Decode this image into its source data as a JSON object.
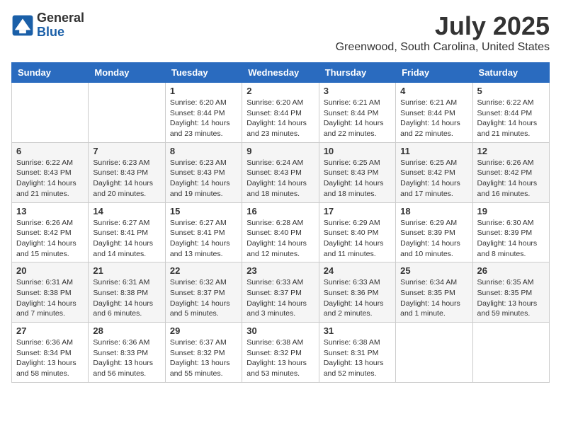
{
  "header": {
    "logo_line1": "General",
    "logo_line2": "Blue",
    "month": "July 2025",
    "location": "Greenwood, South Carolina, United States"
  },
  "weekdays": [
    "Sunday",
    "Monday",
    "Tuesday",
    "Wednesday",
    "Thursday",
    "Friday",
    "Saturday"
  ],
  "weeks": [
    [
      {
        "day": "",
        "info": ""
      },
      {
        "day": "",
        "info": ""
      },
      {
        "day": "1",
        "info": "Sunrise: 6:20 AM\nSunset: 8:44 PM\nDaylight: 14 hours and 23 minutes."
      },
      {
        "day": "2",
        "info": "Sunrise: 6:20 AM\nSunset: 8:44 PM\nDaylight: 14 hours and 23 minutes."
      },
      {
        "day": "3",
        "info": "Sunrise: 6:21 AM\nSunset: 8:44 PM\nDaylight: 14 hours and 22 minutes."
      },
      {
        "day": "4",
        "info": "Sunrise: 6:21 AM\nSunset: 8:44 PM\nDaylight: 14 hours and 22 minutes."
      },
      {
        "day": "5",
        "info": "Sunrise: 6:22 AM\nSunset: 8:44 PM\nDaylight: 14 hours and 21 minutes."
      }
    ],
    [
      {
        "day": "6",
        "info": "Sunrise: 6:22 AM\nSunset: 8:43 PM\nDaylight: 14 hours and 21 minutes."
      },
      {
        "day": "7",
        "info": "Sunrise: 6:23 AM\nSunset: 8:43 PM\nDaylight: 14 hours and 20 minutes."
      },
      {
        "day": "8",
        "info": "Sunrise: 6:23 AM\nSunset: 8:43 PM\nDaylight: 14 hours and 19 minutes."
      },
      {
        "day": "9",
        "info": "Sunrise: 6:24 AM\nSunset: 8:43 PM\nDaylight: 14 hours and 18 minutes."
      },
      {
        "day": "10",
        "info": "Sunrise: 6:25 AM\nSunset: 8:43 PM\nDaylight: 14 hours and 18 minutes."
      },
      {
        "day": "11",
        "info": "Sunrise: 6:25 AM\nSunset: 8:42 PM\nDaylight: 14 hours and 17 minutes."
      },
      {
        "day": "12",
        "info": "Sunrise: 6:26 AM\nSunset: 8:42 PM\nDaylight: 14 hours and 16 minutes."
      }
    ],
    [
      {
        "day": "13",
        "info": "Sunrise: 6:26 AM\nSunset: 8:42 PM\nDaylight: 14 hours and 15 minutes."
      },
      {
        "day": "14",
        "info": "Sunrise: 6:27 AM\nSunset: 8:41 PM\nDaylight: 14 hours and 14 minutes."
      },
      {
        "day": "15",
        "info": "Sunrise: 6:27 AM\nSunset: 8:41 PM\nDaylight: 14 hours and 13 minutes."
      },
      {
        "day": "16",
        "info": "Sunrise: 6:28 AM\nSunset: 8:40 PM\nDaylight: 14 hours and 12 minutes."
      },
      {
        "day": "17",
        "info": "Sunrise: 6:29 AM\nSunset: 8:40 PM\nDaylight: 14 hours and 11 minutes."
      },
      {
        "day": "18",
        "info": "Sunrise: 6:29 AM\nSunset: 8:39 PM\nDaylight: 14 hours and 10 minutes."
      },
      {
        "day": "19",
        "info": "Sunrise: 6:30 AM\nSunset: 8:39 PM\nDaylight: 14 hours and 8 minutes."
      }
    ],
    [
      {
        "day": "20",
        "info": "Sunrise: 6:31 AM\nSunset: 8:38 PM\nDaylight: 14 hours and 7 minutes."
      },
      {
        "day": "21",
        "info": "Sunrise: 6:31 AM\nSunset: 8:38 PM\nDaylight: 14 hours and 6 minutes."
      },
      {
        "day": "22",
        "info": "Sunrise: 6:32 AM\nSunset: 8:37 PM\nDaylight: 14 hours and 5 minutes."
      },
      {
        "day": "23",
        "info": "Sunrise: 6:33 AM\nSunset: 8:37 PM\nDaylight: 14 hours and 3 minutes."
      },
      {
        "day": "24",
        "info": "Sunrise: 6:33 AM\nSunset: 8:36 PM\nDaylight: 14 hours and 2 minutes."
      },
      {
        "day": "25",
        "info": "Sunrise: 6:34 AM\nSunset: 8:35 PM\nDaylight: 14 hours and 1 minute."
      },
      {
        "day": "26",
        "info": "Sunrise: 6:35 AM\nSunset: 8:35 PM\nDaylight: 13 hours and 59 minutes."
      }
    ],
    [
      {
        "day": "27",
        "info": "Sunrise: 6:36 AM\nSunset: 8:34 PM\nDaylight: 13 hours and 58 minutes."
      },
      {
        "day": "28",
        "info": "Sunrise: 6:36 AM\nSunset: 8:33 PM\nDaylight: 13 hours and 56 minutes."
      },
      {
        "day": "29",
        "info": "Sunrise: 6:37 AM\nSunset: 8:32 PM\nDaylight: 13 hours and 55 minutes."
      },
      {
        "day": "30",
        "info": "Sunrise: 6:38 AM\nSunset: 8:32 PM\nDaylight: 13 hours and 53 minutes."
      },
      {
        "day": "31",
        "info": "Sunrise: 6:38 AM\nSunset: 8:31 PM\nDaylight: 13 hours and 52 minutes."
      },
      {
        "day": "",
        "info": ""
      },
      {
        "day": "",
        "info": ""
      }
    ]
  ]
}
